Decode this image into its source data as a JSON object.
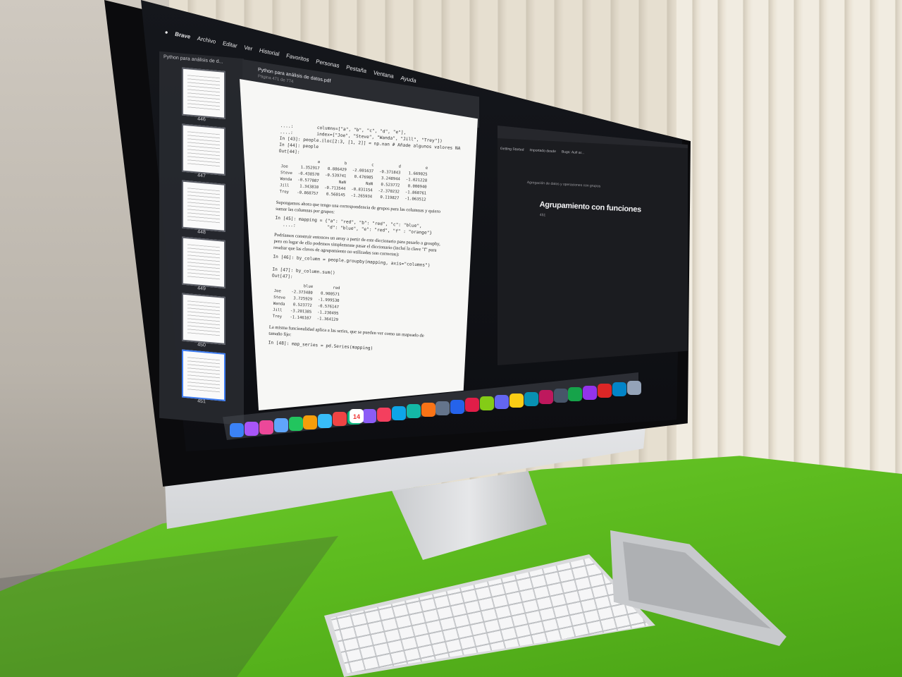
{
  "menubar": {
    "apple": "",
    "brand": "Brave",
    "items": [
      "Archivo",
      "Editar",
      "Ver",
      "Historial",
      "Favoritos",
      "Personas",
      "Pestaña",
      "Ventana",
      "Ayuda"
    ]
  },
  "sidebar": {
    "title": "Python para análisis de d...",
    "pages": [
      "446",
      "447",
      "448",
      "449",
      "450",
      "451"
    ]
  },
  "pdf": {
    "title": "Python para análisis de datos.pdf",
    "subtitle": "Página 471 de 774",
    "code1": "....:         columns=[\"a\", \"b\", \"c\", \"d\", \"e\"],\n....:         index=[\"Joe\", \"Steve\", \"Wanda\", \"Jill\", \"Trey\"])\nIn [43]: people.iloc[2:3, [1, 2]] = np.nan # Añade algunos valores NA\nIn [44]: people\nOut[44]:",
    "table1": {
      "headers": [
        "",
        "a",
        "b",
        "c",
        "d",
        "e"
      ],
      "rows": [
        [
          "Joe",
          "1.352917",
          "0.886429",
          "-2.001637",
          "-0.371843",
          "1.669025"
        ],
        [
          "Steve",
          "-0.438570",
          "-0.539741",
          "0.476985",
          "3.248944",
          "-1.021228"
        ],
        [
          "Wanda",
          "-0.577087",
          "NaN",
          "NaN",
          "0.523772",
          "0.000940"
        ],
        [
          "Jill",
          "1.343810",
          "-0.713544",
          "-0.831154",
          "-2.370232",
          "-1.860761"
        ],
        [
          "Trey",
          "-0.860757",
          "0.560145",
          "-1.265934",
          "0.119827",
          "-1.063512"
        ]
      ]
    },
    "prose1": "Supongamos ahora que tengo una correspondencia de grupos para las columnas y quiero sumar las columnas por grupos:",
    "code2": "In [45]: mapping = {\"a\": \"red\", \"b\": \"red\", \"c\": \"blue\",\n   ....:            \"d\": \"blue\", \"e\": \"red\", \"f\" : \"orange\"}",
    "prose2": "Podríamos construir entonces un array a partir de este diccionario para pasarlo a groupby, pero en lugar de ello podemos simplemente pasar el diccionario (incluí la clave \"f\" para resaltar que las claves de agrupamiento no utilizadas son correctas):",
    "code3": "In [46]: by_column = people.groupby(mapping, axis=\"columns\")\n\nIn [47]: by_column.sum()\nOut[47]:",
    "table2": {
      "headers": [
        "",
        "blue",
        "red"
      ],
      "rows": [
        [
          "Joe",
          "-2.373480",
          "0.900571"
        ],
        [
          "Steve",
          "3.725929",
          "-1.999530"
        ],
        [
          "Wanda",
          "0.523772",
          "-0.576147"
        ],
        [
          "Jill",
          "-3.201385",
          "-1.230495"
        ],
        [
          "Trey",
          "-1.146107",
          "-1.364129"
        ]
      ]
    },
    "prose3": "La misma funcionalidad aplica a las series, que se pueden ver como un mapeado de tamaño fijo:",
    "code4": "In [48]: map_series = pd.Series(mapping)"
  },
  "browser": {
    "bookmarks": [
      "Getting Started",
      "Importado desde",
      "Bugs: Aufi ar..."
    ],
    "breadcrumb": "Agregación de datos y operaciones con grupos",
    "heading": "Agrupamiento con funciones",
    "sub": "451"
  },
  "dock": {
    "date": "14",
    "colors": [
      "#3b82f6",
      "#a855f7",
      "#ec4899",
      "#60a5fa",
      "#22c55e",
      "#f59e0b",
      "#38bdf8",
      "#ef4444",
      "#10b981",
      "#8b5cf6",
      "#f43f5e",
      "#0ea5e9",
      "#14b8a6",
      "#f97316",
      "#64748b",
      "#2563eb",
      "#e11d48",
      "#84cc16",
      "#6366f1",
      "#facc15",
      "#0891b2",
      "#be185d",
      "#475569",
      "#16a34a",
      "#9333ea",
      "#dc2626",
      "#0284c7",
      "#94a3b8"
    ]
  }
}
